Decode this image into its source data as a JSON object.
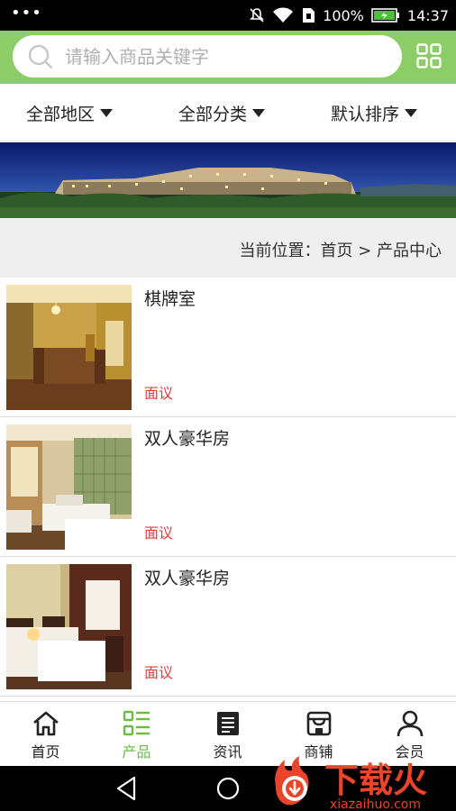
{
  "status_bar": {
    "battery": "100%",
    "time": "14:37"
  },
  "search": {
    "placeholder": "请输入商品关键字",
    "value": ""
  },
  "filters": [
    {
      "label": "全部地区"
    },
    {
      "label": "全部分类"
    },
    {
      "label": "默认排序"
    }
  ],
  "breadcrumb": {
    "text": "当前位置：首页 > 产品中心"
  },
  "products": [
    {
      "name": "棋牌室",
      "price": "面议"
    },
    {
      "name": "双人豪华房",
      "price": "面议"
    },
    {
      "name": "双人豪华房",
      "price": "面议"
    }
  ],
  "bottom_nav": [
    {
      "label": "首页",
      "icon": "home-icon"
    },
    {
      "label": "产品",
      "icon": "list-icon",
      "active": true
    },
    {
      "label": "资讯",
      "icon": "news-icon"
    },
    {
      "label": "商铺",
      "icon": "shop-icon"
    },
    {
      "label": "会员",
      "icon": "user-icon"
    }
  ],
  "watermark": {
    "brand": "下载火",
    "site": "xiazaihuo.com"
  },
  "colors": {
    "header_green": "#8ccd67",
    "active_green": "#6cbb43",
    "price_red": "#e33b3b"
  }
}
